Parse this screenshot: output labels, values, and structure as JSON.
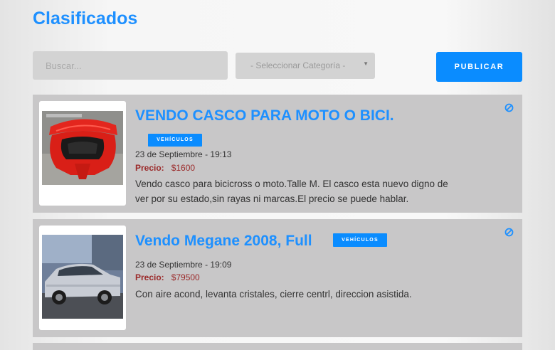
{
  "header": {
    "title": "Clasificados"
  },
  "toolbar": {
    "search_placeholder": "Buscar...",
    "category_selected": "- Seleccionar Categoría -",
    "publish_label": "PUBLICAR"
  },
  "colors": {
    "accent": "#0a8cff",
    "card_bg": "#c8c7c8",
    "price": "#9b2a2a"
  },
  "listings": [
    {
      "title": "VENDO CASCO PARA MOTO O BICI.",
      "category": "VEHÍCULOS",
      "date": "23 de Septiembre - 19:13",
      "price_label": "Precio:",
      "price": "$1600",
      "description": "Vendo casco para bicicross o moto.Talle M. El casco esta nuevo digno de ver por su estado,sin rayas ni marcas.El precio se puede hablar.",
      "image": "red-motorcycle-helmet",
      "action_icon": "block-icon"
    },
    {
      "title": "Vendo Megane 2008, Full",
      "category": "VEHÍCULOS",
      "date": "23 de Septiembre - 19:09",
      "price_label": "Precio:",
      "price": "$79500",
      "description": "Con aire acond, levanta cristales, cierre centrl, direccion asistida.",
      "image": "silver-sedan-car",
      "action_icon": "block-icon"
    }
  ]
}
